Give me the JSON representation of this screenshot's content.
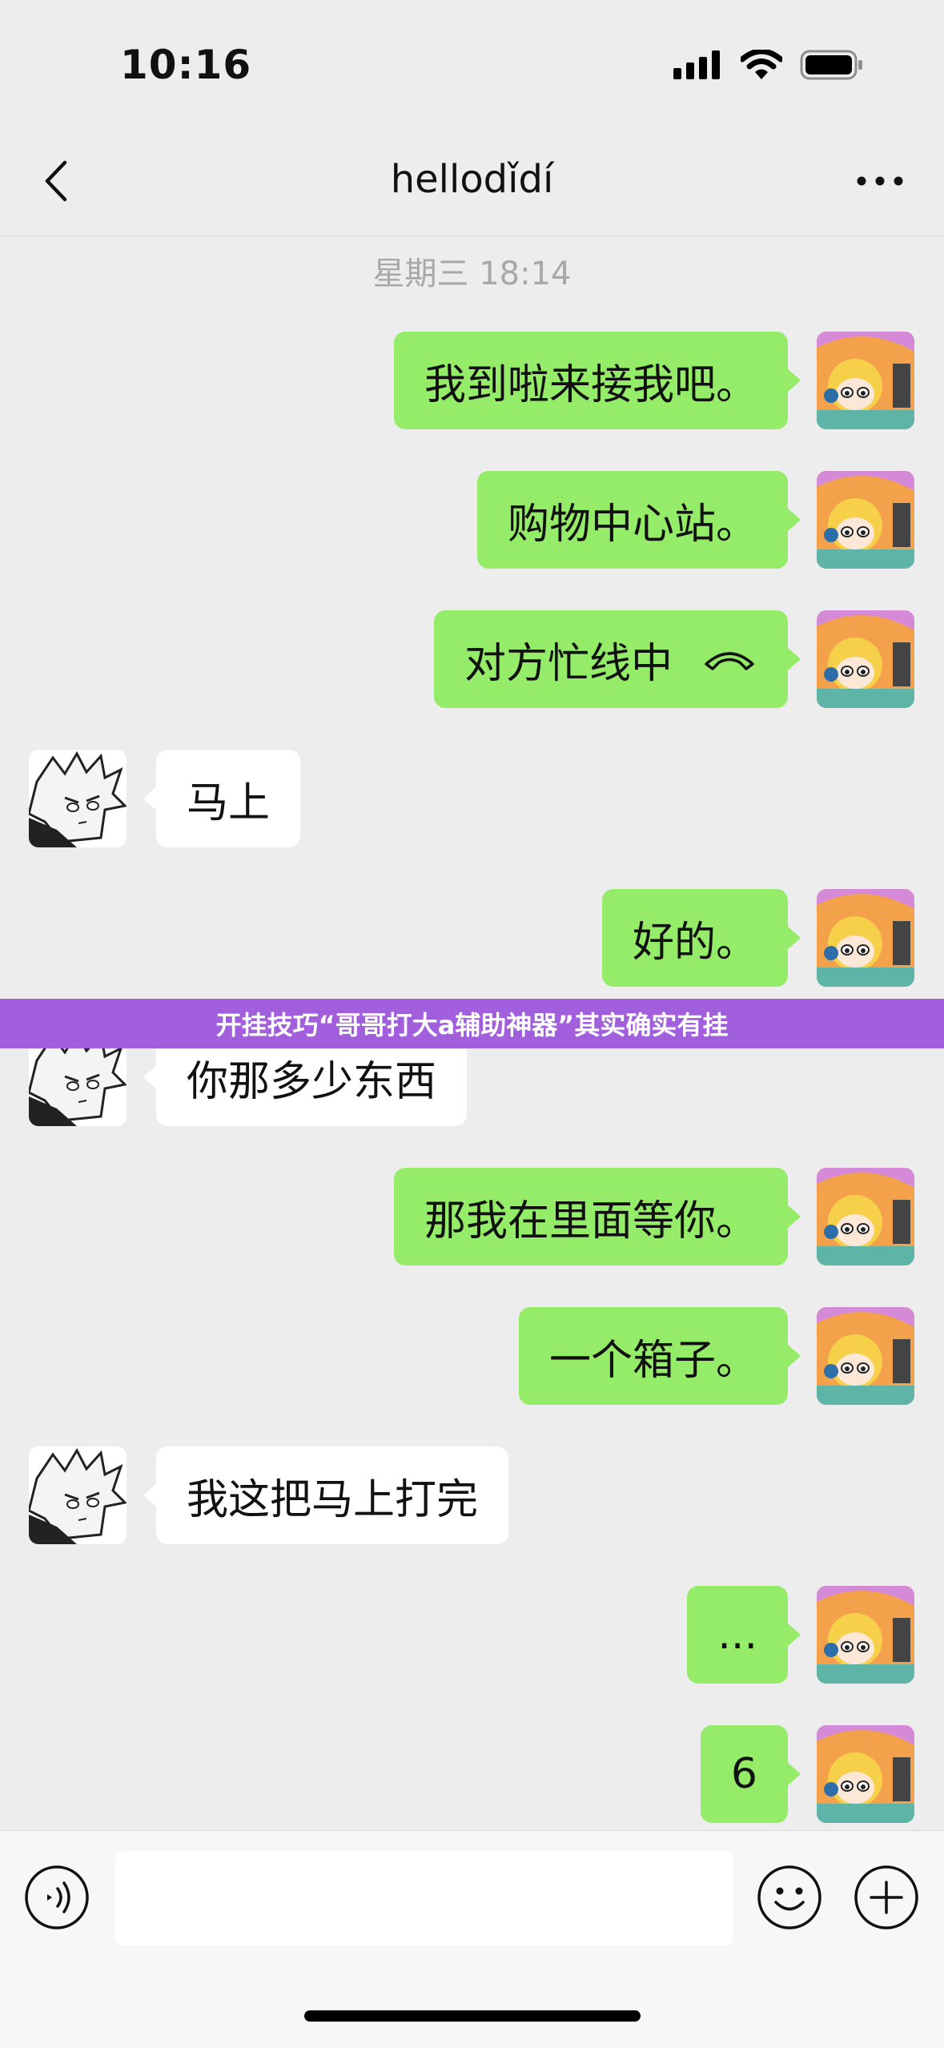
{
  "status_bar": {
    "time": "10:16"
  },
  "nav": {
    "title": "hellodǐdí",
    "back_icon": "chevron-left-icon",
    "more_icon": "ellipsis-icon"
  },
  "chat": {
    "timestamp": "星期三 18:14",
    "messages": [
      {
        "sender": "me",
        "text": "我到啦来接我吧。"
      },
      {
        "sender": "me",
        "text": "购物中心站。"
      },
      {
        "sender": "me",
        "text": "对方忙线中",
        "icon": "hangup-phone-icon"
      },
      {
        "sender": "other",
        "text": "马上"
      },
      {
        "sender": "me",
        "text": "好的。"
      },
      {
        "sender": "other",
        "text": "你那多少东西"
      },
      {
        "sender": "me",
        "text": "那我在里面等你。"
      },
      {
        "sender": "me",
        "text": "一个箱子。"
      },
      {
        "sender": "other",
        "text": "我这把马上打完"
      },
      {
        "sender": "me",
        "text": "..."
      },
      {
        "sender": "me",
        "text": "6"
      }
    ]
  },
  "banner": {
    "text": "开挂技巧“哥哥打大a辅助神器”其实确实有挂"
  },
  "input_bar": {
    "voice_icon": "voice-icon",
    "emoji_icon": "emoji-icon",
    "plus_icon": "plus-circle-icon"
  },
  "colors": {
    "my_bubble": "#95ec69",
    "other_bubble": "#ffffff",
    "banner": "#a25fdd",
    "background": "#ededed"
  }
}
